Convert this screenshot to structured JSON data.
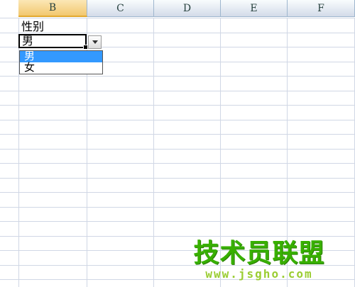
{
  "columns": [
    "B",
    "C",
    "D",
    "E",
    "F"
  ],
  "selected_column": "B",
  "cells": {
    "header_label": "性别",
    "active_value": "男"
  },
  "dropdown": {
    "options": [
      "男",
      "女"
    ],
    "highlighted_index": 0
  },
  "watermark": {
    "title": "技术员联盟",
    "url": "www.jsgho.com"
  },
  "colors": {
    "selected_header": "#f2c86f",
    "grid_line": "#d0d7e5",
    "highlight": "#3399ff",
    "watermark": "#38b000"
  }
}
